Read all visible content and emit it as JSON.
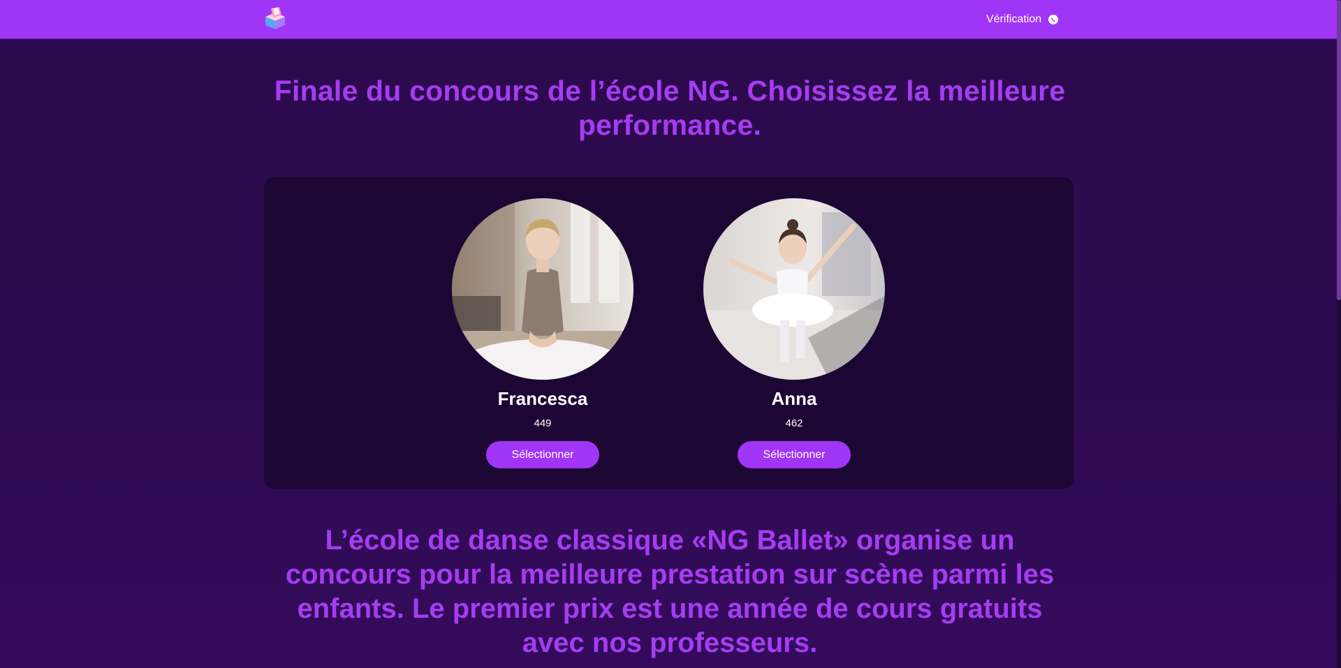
{
  "header": {
    "logo_icon": "ballot-box-icon",
    "nav_link_label": "Vérification",
    "nav_link_icon": "whatsapp-icon",
    "brand_color": "#a135f5"
  },
  "main": {
    "headline": "Finale du concours de l’école NG. Choisissez la meilleure performance.",
    "candidates": [
      {
        "name": "Francesca",
        "votes": "449",
        "button_label": "Sélectionner"
      },
      {
        "name": "Anna",
        "votes": "462",
        "button_label": "Sélectionner"
      }
    ],
    "intro": "L’école de danse classique «NG Ballet» organise un concours pour la meilleure prestation sur scène parmi les enfants. Le premier prix est une année de cours gratuits avec nos professeurs."
  },
  "colors": {
    "background": "#2e0b50",
    "panel": "#1c0634",
    "heading": "#a53cf3",
    "button": "#a135f5",
    "text": "#ffffff"
  }
}
